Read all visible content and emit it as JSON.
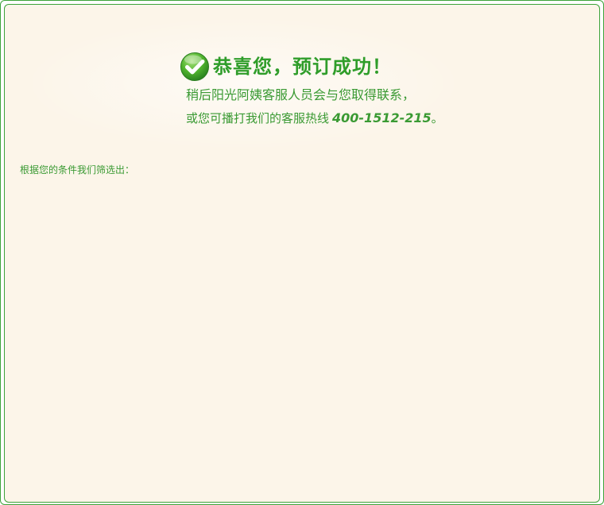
{
  "success": {
    "title": "恭喜您，预订成功！",
    "line1": "稍后阳光阿姨客服人员会与您取得联系，",
    "line2_prefix": "或您可播打我们的客服热线",
    "hotline": "400-1512-215",
    "line2_suffix": "。"
  },
  "results": {
    "label": "根据您的条件我们筛选出："
  },
  "colors": {
    "accent_green": "#3a9a33",
    "border_green": "#3da33a",
    "panel_bg": "#fcf5e9"
  },
  "icons": {
    "success": "check-circle-icon"
  }
}
